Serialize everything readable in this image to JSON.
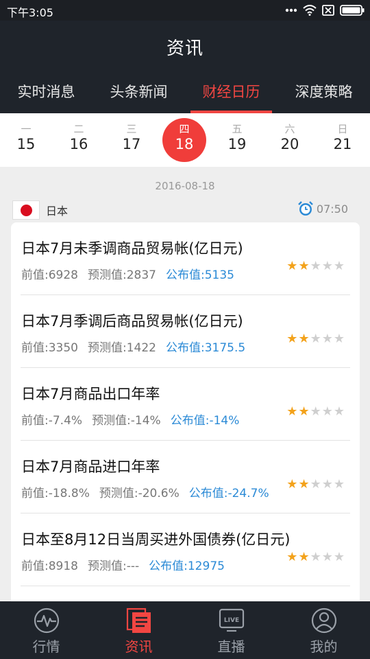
{
  "status_bar": {
    "time": "下午3:05",
    "icons": [
      "dots-icon",
      "wifi-icon",
      "sim-icon",
      "battery-icon"
    ]
  },
  "header": {
    "title": "资讯"
  },
  "tabs": [
    {
      "label": "实时消息",
      "active": false
    },
    {
      "label": "头条新闻",
      "active": false
    },
    {
      "label": "财经日历",
      "active": true
    },
    {
      "label": "深度策略",
      "active": false
    }
  ],
  "week": [
    {
      "weekday": "一",
      "date": "15",
      "active": false
    },
    {
      "weekday": "二",
      "date": "16",
      "active": false
    },
    {
      "weekday": "三",
      "date": "17",
      "active": false
    },
    {
      "weekday": "四",
      "date": "18",
      "active": true
    },
    {
      "weekday": "五",
      "date": "19",
      "active": false
    },
    {
      "weekday": "六",
      "date": "20",
      "active": false
    },
    {
      "weekday": "日",
      "date": "21",
      "active": false
    }
  ],
  "selected_date": "2016-08-18",
  "group": {
    "country": "日本",
    "flag": "japan-flag-icon",
    "time": "07:50"
  },
  "events": [
    {
      "title": "日本7月未季调商品贸易帐(亿日元)",
      "previous": "前值:6928",
      "forecast": "预测值:2837",
      "actual": "公布值:5135",
      "importance": 2
    },
    {
      "title": "日本7月季调后商品贸易帐(亿日元)",
      "previous": "前值:3350",
      "forecast": "预测值:1422",
      "actual": "公布值:3175.5",
      "importance": 2
    },
    {
      "title": "日本7月商品出口年率",
      "previous": "前值:-7.4%",
      "forecast": "预测值:-14%",
      "actual": "公布值:-14%",
      "importance": 2
    },
    {
      "title": "日本7月商品进口年率",
      "previous": "前值:-18.8%",
      "forecast": "预测值:-20.6%",
      "actual": "公布值:-24.7%",
      "importance": 2
    },
    {
      "title": "日本至8月12日当周买进外国债券(亿日元)",
      "previous": "前值:8918",
      "forecast": "预测值:---",
      "actual": "公布值:12975",
      "importance": 2
    }
  ],
  "bottom_nav": [
    {
      "label": "行情",
      "icon": "pulse-chart-icon",
      "active": false
    },
    {
      "label": "资讯",
      "icon": "news-document-icon",
      "active": true
    },
    {
      "label": "直播",
      "icon": "live-tv-icon",
      "active": false
    },
    {
      "label": "我的",
      "icon": "user-profile-icon",
      "active": false
    }
  ],
  "colors": {
    "accent": "#f24642",
    "published_value": "#2b8ad6",
    "star_on": "#f3a21b",
    "dark_bar": "#1f242b"
  }
}
